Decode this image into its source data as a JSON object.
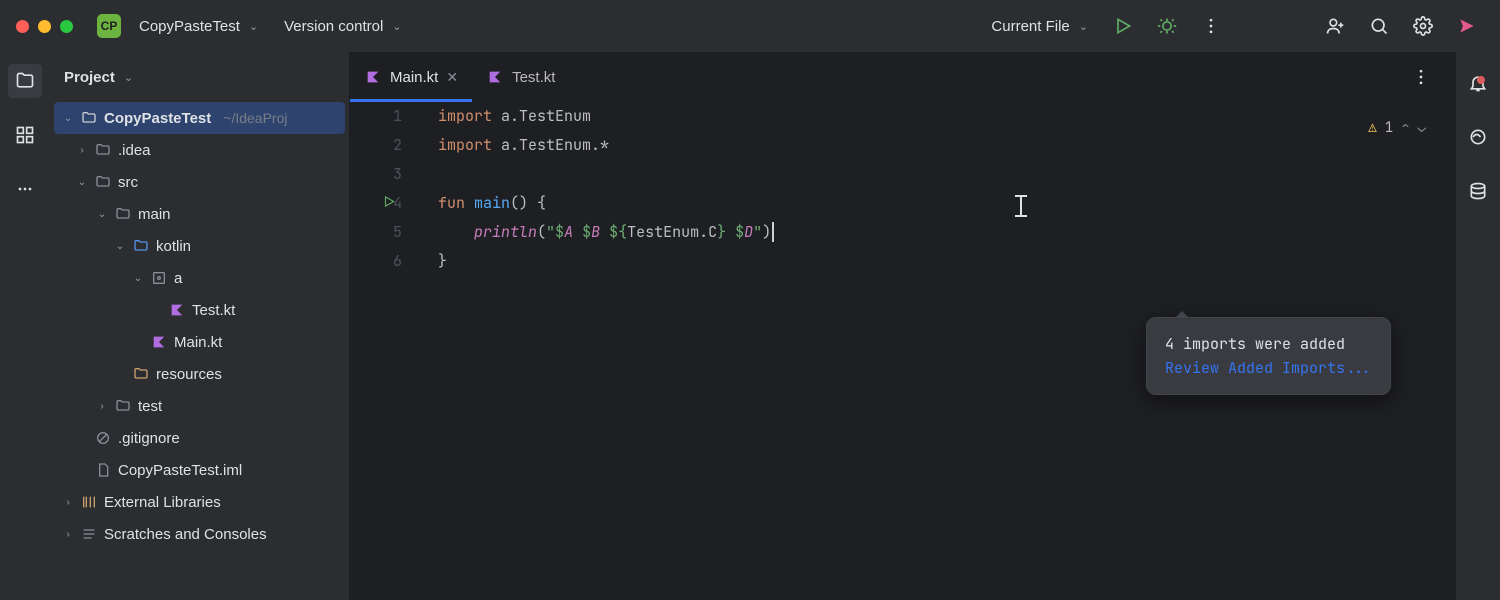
{
  "titlebar": {
    "project_icon_text": "CP",
    "project_name": "CopyPasteTest",
    "vcs_label": "Version control",
    "run_config": "Current File"
  },
  "tree": {
    "header": "Project",
    "root": "CopyPasteTest",
    "root_path": "~/IdeaProj",
    "idea": ".idea",
    "src": "src",
    "main": "main",
    "kotlin": "kotlin",
    "pkg_a": "a",
    "test_kt": "Test.kt",
    "main_kt": "Main.kt",
    "resources": "resources",
    "test": "test",
    "gitignore": ".gitignore",
    "iml": "CopyPasteTest.iml",
    "ext_lib": "External Libraries",
    "scratches": "Scratches and Consoles"
  },
  "tabs": {
    "active": "Main.kt",
    "other": "Test.kt"
  },
  "code": {
    "line_numbers": [
      "1",
      "2",
      "3",
      "4",
      "5",
      "6"
    ],
    "l1_kw": "import",
    "l1_rest": " a.TestEnum",
    "l2_kw": "import",
    "l2_rest": " a.TestEnum.*",
    "l4_fun": "fun",
    "l4_main": "main",
    "l4_rest": "() {",
    "l5_println": "println",
    "l5_open": "(",
    "l5_s1": "\"$",
    "l5_a": "A",
    "l5_s2": " $",
    "l5_b": "B",
    "l5_s3": " ${",
    "l5_te": "TestEnum.C",
    "l5_s4": "} $",
    "l5_d": "D",
    "l5_s5": "\"",
    "l5_close": ")",
    "l6": "}"
  },
  "inspections": {
    "warn_count": "1"
  },
  "popup": {
    "msg": "4 imports were added",
    "link": "Review Added Imports..."
  }
}
